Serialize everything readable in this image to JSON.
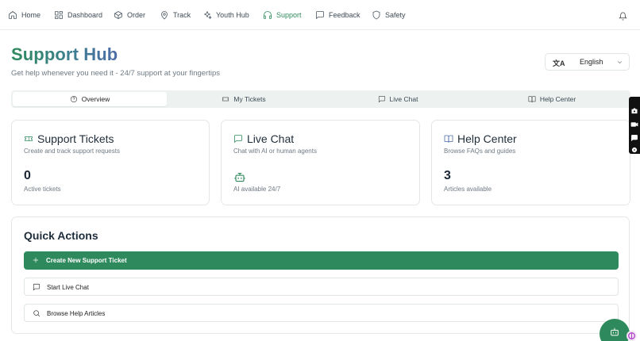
{
  "nav": {
    "items": [
      {
        "label": "Home",
        "icon": "home-icon"
      },
      {
        "label": "Dashboard",
        "icon": "grid-icon"
      },
      {
        "label": "Order",
        "icon": "box-icon"
      },
      {
        "label": "Track",
        "icon": "map-pin-icon"
      },
      {
        "label": "Youth Hub",
        "icon": "sparkles-icon"
      },
      {
        "label": "Support",
        "icon": "headphones-icon",
        "active": true
      },
      {
        "label": "Feedback",
        "icon": "message-square-icon"
      },
      {
        "label": "Safety",
        "icon": "shield-icon"
      }
    ],
    "bell_icon": "bell-icon"
  },
  "header": {
    "title": "Support Hub",
    "subtitle": "Get help whenever you need it - 24/7 support at your fingertips"
  },
  "language": {
    "icon": "translate-icon",
    "value": "English"
  },
  "tabs": [
    {
      "label": "Overview",
      "icon": "help-circle-icon",
      "active": true
    },
    {
      "label": "My Tickets",
      "icon": "ticket-icon"
    },
    {
      "label": "Live Chat",
      "icon": "message-square-icon"
    },
    {
      "label": "Help Center",
      "icon": "book-open-icon"
    }
  ],
  "cards": {
    "tickets": {
      "title": "Support Tickets",
      "description": "Create and track support requests",
      "value": "0",
      "caption": "Active tickets"
    },
    "chat": {
      "title": "Live Chat",
      "description": "Chat with AI or human agents",
      "caption": "AI available 24/7"
    },
    "help": {
      "title": "Help Center",
      "description": "Browse FAQs and guides",
      "value": "3",
      "caption": "Articles available"
    }
  },
  "quick_actions": {
    "title": "Quick Actions",
    "create_label": "Create New Support Ticket",
    "chat_label": "Start Live Chat",
    "browse_label": "Browse Help Articles"
  },
  "colors": {
    "accent": "#2e8a5c",
    "title_gradient_end": "#4d6ca8"
  }
}
